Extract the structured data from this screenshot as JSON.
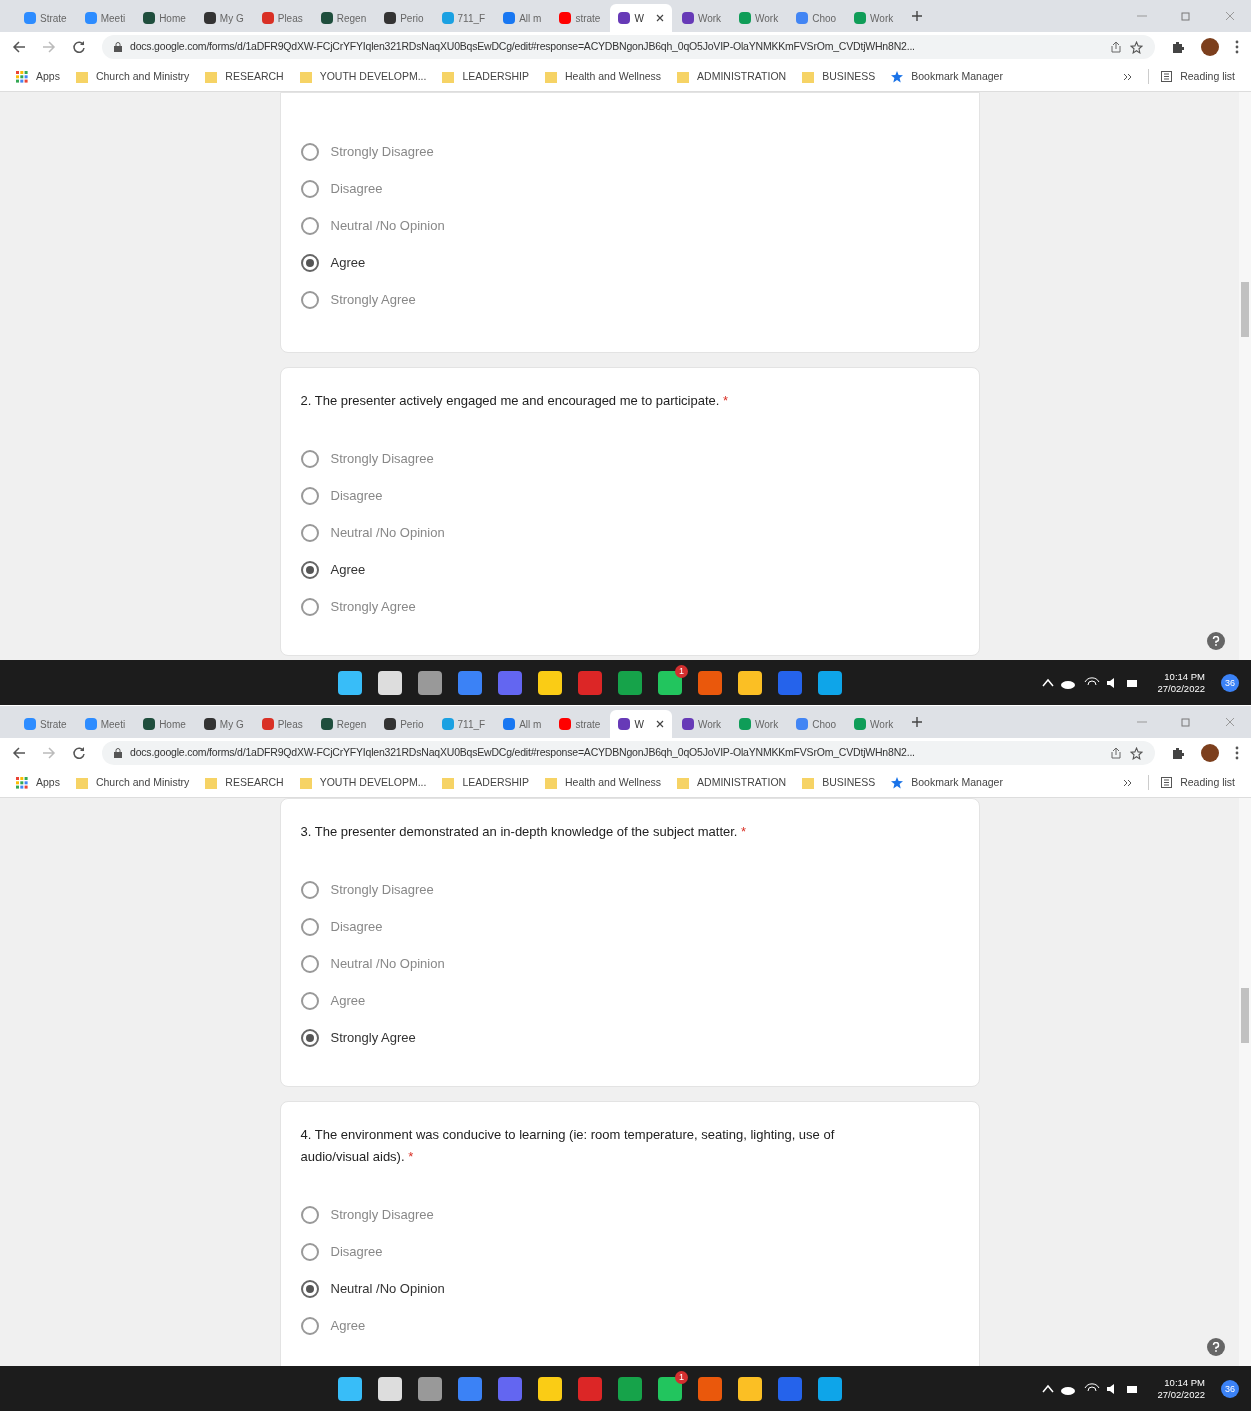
{
  "screens": [
    {
      "tabs": [
        {
          "label": "Strate",
          "color": "#2d8cff",
          "selected": false
        },
        {
          "label": "Meeti",
          "color": "#2d8cff",
          "selected": false
        },
        {
          "label": "Home",
          "color": "#1f4e3d",
          "selected": false
        },
        {
          "label": "My G",
          "color": "#333333",
          "selected": false
        },
        {
          "label": "Pleas",
          "color": "#d93025",
          "selected": false
        },
        {
          "label": "Regen",
          "color": "#1f4e3d",
          "selected": false
        },
        {
          "label": "Perio",
          "color": "#333333",
          "selected": false
        },
        {
          "label": "711_F",
          "color": "#1ba1e2",
          "selected": false
        },
        {
          "label": "All m",
          "color": "#1877f2",
          "selected": false
        },
        {
          "label": "strate",
          "color": "#ff0000",
          "selected": false
        },
        {
          "label": "W",
          "color": "#673ab7",
          "selected": true
        },
        {
          "label": "Work",
          "color": "#673ab7",
          "selected": false
        },
        {
          "label": "Work",
          "color": "#0f9d58",
          "selected": false
        },
        {
          "label": "Choo",
          "color": "#4285f4",
          "selected": false
        },
        {
          "label": "Work",
          "color": "#0f9d58",
          "selected": false
        }
      ],
      "url": "docs.google.com/forms/d/1aDFR9QdXW-FCjCrYFYIqlen321RDsNaqXU0BqsEwDCg/edit#response=ACYDBNgonJB6qh_0qO5JoVIP-OlaYNMKKmFVSrOm_CVDtjWHn8N2...",
      "bookmarks": [
        {
          "label": "Apps",
          "kind": "apps"
        },
        {
          "label": "Church and Ministry",
          "kind": "folder"
        },
        {
          "label": "RESEARCH",
          "kind": "folder"
        },
        {
          "label": "YOUTH DEVELOPM...",
          "kind": "folder"
        },
        {
          "label": "LEADERSHIP",
          "kind": "folder"
        },
        {
          "label": "Health and Wellness",
          "kind": "folder"
        },
        {
          "label": "ADMINISTRATION",
          "kind": "folder"
        },
        {
          "label": "BUSINESS",
          "kind": "folder"
        },
        {
          "label": "Bookmark Manager",
          "kind": "star"
        }
      ],
      "reading_list": "Reading list",
      "questions": [
        {
          "options": [
            {
              "label": "Strongly Disagree",
              "selected": false
            },
            {
              "label": "Disagree",
              "selected": false
            },
            {
              "label": "Neutral /No Opinion",
              "selected": false
            },
            {
              "label": "Agree",
              "selected": true
            },
            {
              "label": "Strongly Agree",
              "selected": false
            }
          ]
        },
        {
          "title": "2. The presenter actively engaged me and encouraged me to participate.",
          "required": "*",
          "options": [
            {
              "label": "Strongly Disagree",
              "selected": false
            },
            {
              "label": "Disagree",
              "selected": false
            },
            {
              "label": "Neutral /No Opinion",
              "selected": false
            },
            {
              "label": "Agree",
              "selected": true
            },
            {
              "label": "Strongly Agree",
              "selected": false
            }
          ]
        }
      ],
      "taskbar": {
        "badge": "1",
        "time": "10:14 PM",
        "date": "27/02/2022",
        "notifications": "36"
      }
    },
    {
      "tabs": [
        {
          "label": "Strate",
          "color": "#2d8cff",
          "selected": false
        },
        {
          "label": "Meeti",
          "color": "#2d8cff",
          "selected": false
        },
        {
          "label": "Home",
          "color": "#1f4e3d",
          "selected": false
        },
        {
          "label": "My G",
          "color": "#333333",
          "selected": false
        },
        {
          "label": "Pleas",
          "color": "#d93025",
          "selected": false
        },
        {
          "label": "Regen",
          "color": "#1f4e3d",
          "selected": false
        },
        {
          "label": "Perio",
          "color": "#333333",
          "selected": false
        },
        {
          "label": "711_F",
          "color": "#1ba1e2",
          "selected": false
        },
        {
          "label": "All m",
          "color": "#1877f2",
          "selected": false
        },
        {
          "label": "strate",
          "color": "#ff0000",
          "selected": false
        },
        {
          "label": "W",
          "color": "#673ab7",
          "selected": true
        },
        {
          "label": "Work",
          "color": "#673ab7",
          "selected": false
        },
        {
          "label": "Work",
          "color": "#0f9d58",
          "selected": false
        },
        {
          "label": "Choo",
          "color": "#4285f4",
          "selected": false
        },
        {
          "label": "Work",
          "color": "#0f9d58",
          "selected": false
        }
      ],
      "url": "docs.google.com/forms/d/1aDFR9QdXW-FCjCrYFYIqlen321RDsNaqXU0BqsEwDCg/edit#response=ACYDBNgonJB6qh_0qO5JoVIP-OlaYNMKKmFVSrOm_CVDtjWHn8N2...",
      "bookmarks": [
        {
          "label": "Apps",
          "kind": "apps"
        },
        {
          "label": "Church and Ministry",
          "kind": "folder"
        },
        {
          "label": "RESEARCH",
          "kind": "folder"
        },
        {
          "label": "YOUTH DEVELOPM...",
          "kind": "folder"
        },
        {
          "label": "LEADERSHIP",
          "kind": "folder"
        },
        {
          "label": "Health and Wellness",
          "kind": "folder"
        },
        {
          "label": "ADMINISTRATION",
          "kind": "folder"
        },
        {
          "label": "BUSINESS",
          "kind": "folder"
        },
        {
          "label": "Bookmark Manager",
          "kind": "star"
        }
      ],
      "reading_list": "Reading list",
      "questions": [
        {
          "title": "3. The presenter demonstrated an in-depth knowledge of the subject matter.",
          "required": "*",
          "options": [
            {
              "label": "Strongly Disagree",
              "selected": false
            },
            {
              "label": "Disagree",
              "selected": false
            },
            {
              "label": "Neutral /No Opinion",
              "selected": false
            },
            {
              "label": "Agree",
              "selected": false
            },
            {
              "label": "Strongly Agree",
              "selected": true
            }
          ]
        },
        {
          "title": "4. The environment was conducive to learning (ie: room temperature, seating, lighting, use of audio/visual aids).",
          "required": "*",
          "options": [
            {
              "label": "Strongly Disagree",
              "selected": false
            },
            {
              "label": "Disagree",
              "selected": false
            },
            {
              "label": "Neutral /No Opinion",
              "selected": true
            },
            {
              "label": "Agree",
              "selected": false
            }
          ]
        }
      ],
      "taskbar": {
        "badge": "1",
        "time": "10:14 PM",
        "date": "27/02/2022",
        "notifications": "36"
      }
    }
  ]
}
